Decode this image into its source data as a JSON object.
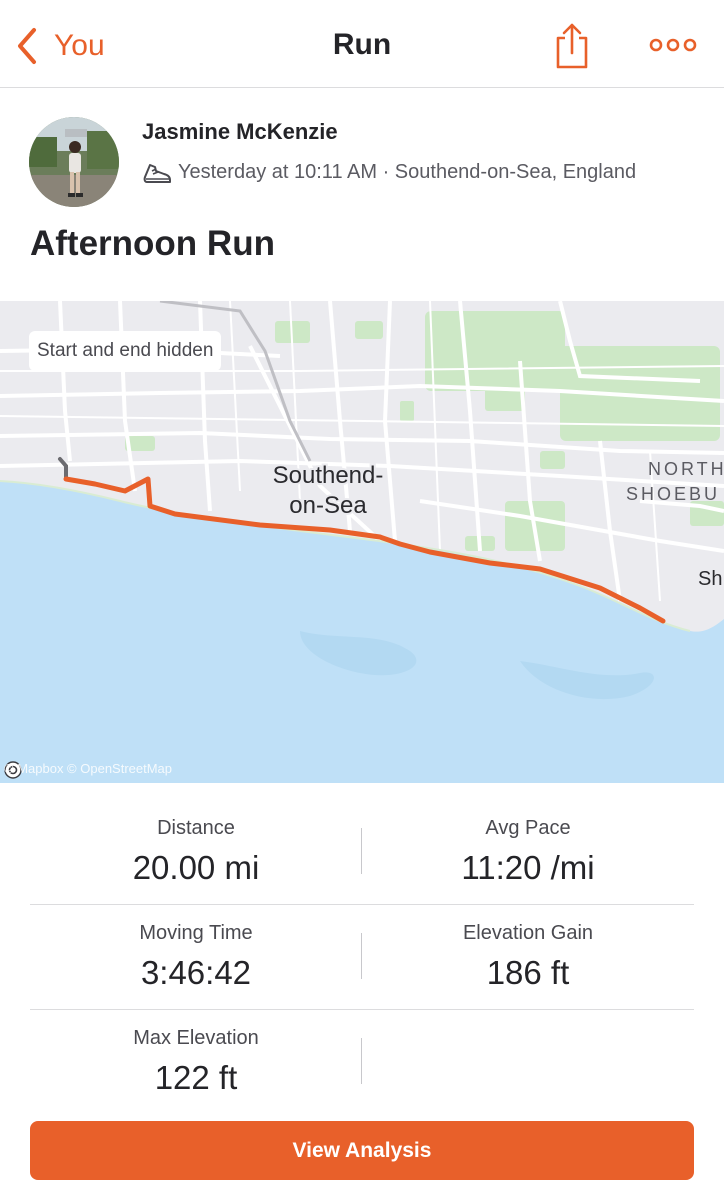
{
  "nav": {
    "back_label": "You",
    "title": "Run",
    "back_icon": "chevron-left-icon",
    "share_icon": "share-icon",
    "more_icon": "more-horizontal-icon"
  },
  "activity": {
    "athlete_name": "Jasmine McKenzie",
    "meta": "Yesterday at 10:11 AM · Southend-on-Sea, England",
    "sport_icon": "running-shoe-icon",
    "title": "Afternoon Run"
  },
  "map": {
    "privacy_label": "Start and end hidden",
    "place_label_line1": "Southend-",
    "place_label_line2": "on-Sea",
    "edge_label_north_1": "NORTH",
    "edge_label_north_2": "SHOEBU",
    "edge_label_sh": "Sh",
    "attribution": "© Mapbox © OpenStreetMap",
    "route_color": "#e8602a",
    "water_color": "#bfe0f7"
  },
  "stats": {
    "distance": {
      "label": "Distance",
      "value": "20.00 mi"
    },
    "avg_pace": {
      "label": "Avg Pace",
      "value": "11:20 /mi"
    },
    "moving_time": {
      "label": "Moving Time",
      "value": "3:46:42"
    },
    "elevation_gain": {
      "label": "Elevation Gain",
      "value": "186 ft"
    },
    "max_elevation": {
      "label": "Max Elevation",
      "value": "122 ft"
    }
  },
  "actions": {
    "view_analysis": "View Analysis"
  },
  "colors": {
    "accent": "#e8602a",
    "text": "#242428",
    "muted": "#4a4a50"
  }
}
